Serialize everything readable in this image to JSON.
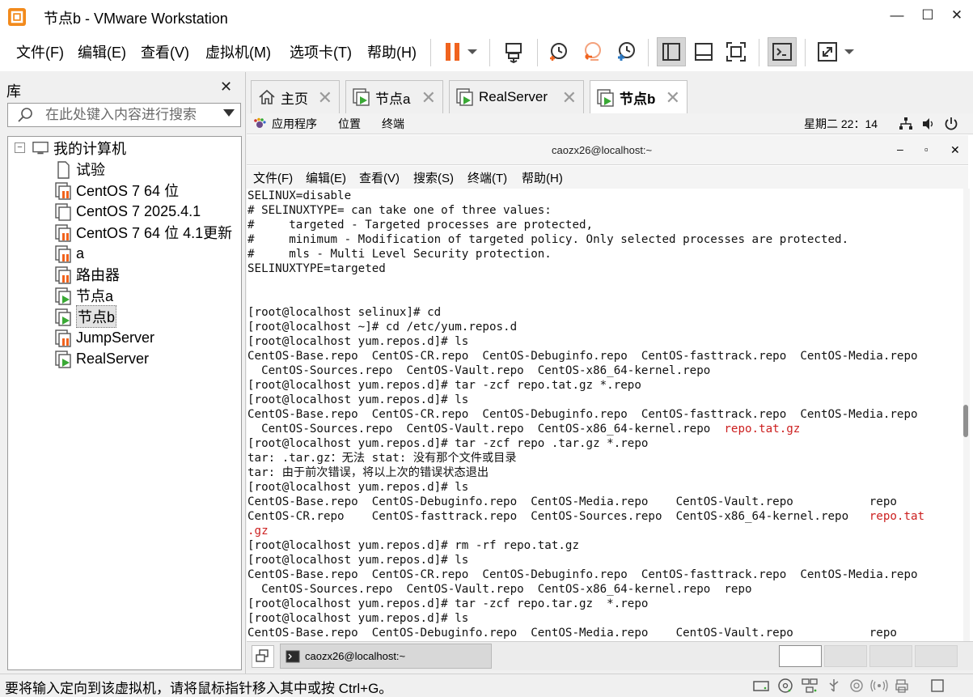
{
  "window": {
    "title": "节点b - VMware Workstation",
    "min_glyph": "—",
    "max_glyph": "☐",
    "close_glyph": "✕"
  },
  "menu": [
    "文件(F)",
    "编辑(E)",
    "查看(V)",
    "虚拟机(M)",
    "选项卡(T)",
    "帮助(H)"
  ],
  "library": {
    "title": "库",
    "close_glyph": "✕",
    "search_placeholder": "在此处键入内容进行搜索",
    "tree_toggle": "−",
    "root": "我的计算机",
    "items": [
      "试验",
      "CentOS 7 64 位",
      "CentOS 7 2025.4.1",
      "CentOS 7 64 位 4.1更新",
      "a",
      "路由器",
      "节点a",
      "节点b",
      "JumpServer",
      "RealServer"
    ]
  },
  "tabs": [
    {
      "label": "主页",
      "close": "✕"
    },
    {
      "label": "节点a",
      "close": "✕"
    },
    {
      "label": "RealServer",
      "close": "✕"
    },
    {
      "label": "节点b",
      "close": "✕"
    }
  ],
  "gnome": {
    "apps": "应用程序",
    "places": "位置",
    "terminal": "终端",
    "clock": "星期二 22：14"
  },
  "terminal_window": {
    "title": "caozx26@localhost:~",
    "min_glyph": "–",
    "max_glyph": "▫",
    "close_glyph": "✕",
    "menu": [
      "文件(F)",
      "编辑(E)",
      "查看(V)",
      "搜索(S)",
      "终端(T)",
      "帮助(H)"
    ]
  },
  "terminal_lines": [
    {
      "t": "SELINUX=disable"
    },
    {
      "t": "# SELINUXTYPE= can take one of three values:"
    },
    {
      "t": "#     targeted - Targeted processes are protected,"
    },
    {
      "t": "#     minimum - Modification of targeted policy. Only selected processes are protected."
    },
    {
      "t": "#     mls - Multi Level Security protection."
    },
    {
      "t": "SELINUXTYPE=targeted"
    },
    {
      "t": ""
    },
    {
      "t": ""
    },
    {
      "t": "[root@localhost selinux]# cd"
    },
    {
      "t": "[root@localhost ~]# cd /etc/yum.repos.d"
    },
    {
      "t": "[root@localhost yum.repos.d]# ls"
    },
    {
      "t": "CentOS-Base.repo  CentOS-CR.repo  CentOS-Debuginfo.repo  CentOS-fasttrack.repo  CentOS-Media.repo"
    },
    {
      "t": "  CentOS-Sources.repo  CentOS-Vault.repo  CentOS-x86_64-kernel.repo"
    },
    {
      "t": "[root@localhost yum.repos.d]# tar -zcf repo.tat.gz *.repo"
    },
    {
      "t": "[root@localhost yum.repos.d]# ls"
    },
    {
      "t": "CentOS-Base.repo  CentOS-CR.repo  CentOS-Debuginfo.repo  CentOS-fasttrack.repo  CentOS-Media.repo"
    },
    {
      "t": "  CentOS-Sources.repo  CentOS-Vault.repo  CentOS-x86_64-kernel.repo  ",
      "r": "repo.tat.gz"
    },
    {
      "t": "[root@localhost yum.repos.d]# tar -zcf repo .tar.gz *.repo"
    },
    {
      "t": "tar: .tar.gz：无法 stat: 没有那个文件或目录"
    },
    {
      "t": "tar: 由于前次错误，将以上次的错误状态退出"
    },
    {
      "t": "[root@localhost yum.repos.d]# ls"
    },
    {
      "t": "CentOS-Base.repo  CentOS-Debuginfo.repo  CentOS-Media.repo    CentOS-Vault.repo           repo"
    },
    {
      "t": "CentOS-CR.repo    CentOS-fasttrack.repo  CentOS-Sources.repo  CentOS-x86_64-kernel.repo   ",
      "r": "repo.tat"
    },
    {
      "t": "",
      "r": ".gz"
    },
    {
      "t": "[root@localhost yum.repos.d]# rm -rf repo.tat.gz"
    },
    {
      "t": "[root@localhost yum.repos.d]# ls"
    },
    {
      "t": "CentOS-Base.repo  CentOS-CR.repo  CentOS-Debuginfo.repo  CentOS-fasttrack.repo  CentOS-Media.repo"
    },
    {
      "t": "  CentOS-Sources.repo  CentOS-Vault.repo  CentOS-x86_64-kernel.repo  repo"
    },
    {
      "t": "[root@localhost yum.repos.d]# tar -zcf repo.tar.gz  *.repo"
    },
    {
      "t": "[root@localhost yum.repos.d]# ls"
    },
    {
      "t": "CentOS-Base.repo  CentOS-Debuginfo.repo  CentOS-Media.repo    CentOS-Vault.repo           repo"
    }
  ],
  "taskbar": {
    "task_label": "caozx26@localhost:~"
  },
  "status": {
    "text": "要将输入定向到该虚拟机，请将鼠标指针移入其中或按 Ctrl+G。"
  },
  "colors": {
    "accent_orange": "#f0631e",
    "vm_green": "#3aa935",
    "terminal_red": "#cc1f1f"
  }
}
